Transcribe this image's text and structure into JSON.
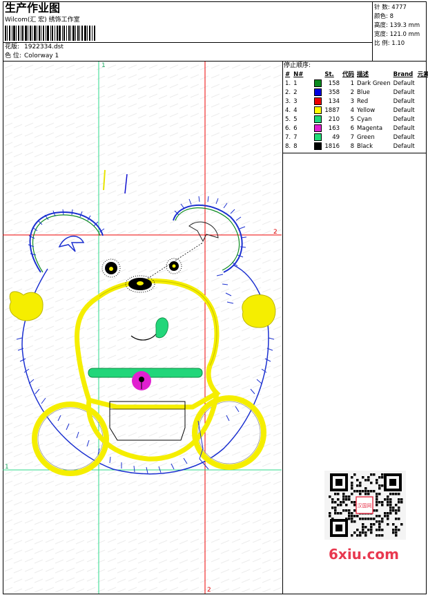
{
  "header": {
    "title": "生产作业图",
    "subtitle": "Wilcom(汇 宏) 绣饰工作室",
    "design_label": "花版:",
    "design_value": "1922334.dst",
    "colorway_label": "色 位:",
    "colorway_value": "Colorway 1"
  },
  "stats": [
    {
      "label": "针 数:",
      "value": "4777"
    },
    {
      "label": "颜色:",
      "value": "8"
    },
    {
      "label": "高度:",
      "value": "139.3 mm"
    },
    {
      "label": "宽度:",
      "value": "121.0 mm"
    },
    {
      "label": "比 例:",
      "value": "1.10"
    }
  ],
  "stop_sequence": {
    "title": "停止顺序:",
    "headers": [
      "#",
      "N#",
      "St.",
      "代码",
      "描述",
      "Brand",
      "元素"
    ],
    "rows": [
      {
        "num": "1.",
        "n": "1",
        "color": "#0a8a1e",
        "st": "158",
        "code": "1",
        "desc": "Dark Green",
        "brand": "Default"
      },
      {
        "num": "2.",
        "n": "2",
        "color": "#0000e0",
        "st": "358",
        "code": "2",
        "desc": "Blue",
        "brand": "Default"
      },
      {
        "num": "3.",
        "n": "3",
        "color": "#ee0000",
        "st": "134",
        "code": "3",
        "desc": "Red",
        "brand": "Default"
      },
      {
        "num": "4.",
        "n": "4",
        "color": "#ffff00",
        "st": "1887",
        "code": "4",
        "desc": "Yellow",
        "brand": "Default"
      },
      {
        "num": "5.",
        "n": "5",
        "color": "#20d67a",
        "st": "210",
        "code": "5",
        "desc": "Cyan",
        "brand": "Default"
      },
      {
        "num": "6.",
        "n": "6",
        "color": "#e020d0",
        "st": "163",
        "code": "6",
        "desc": "Magenta",
        "brand": "Default"
      },
      {
        "num": "7.",
        "n": "7",
        "color": "#22dd77",
        "st": "49",
        "code": "7",
        "desc": "Green",
        "brand": "Default"
      },
      {
        "num": "8.",
        "n": "8",
        "color": "#000000",
        "st": "1816",
        "code": "8",
        "desc": "Black",
        "brand": "Default"
      }
    ]
  },
  "guides": {
    "v1": "1",
    "h2": "2",
    "h1": "1",
    "v2": "2"
  },
  "watermark": "6xiu.com",
  "qr_caption": "汉国网"
}
